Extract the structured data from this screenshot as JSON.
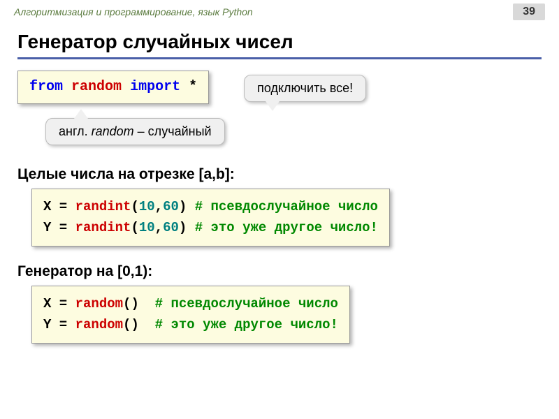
{
  "header": {
    "breadcrumb": "Алгоритмизация и программирование, язык Python",
    "page": "39"
  },
  "title": "Генератор случайных чисел",
  "import_line": {
    "kw_from": "from",
    "mod": "random",
    "kw_import": "import",
    "star": "*"
  },
  "callout_connect": "подключить все!",
  "callout_random": {
    "prefix": "англ. ",
    "word": "random",
    "suffix": " – случайный"
  },
  "section_int": "Целые числа на отрезке [a,b]:",
  "code_int": {
    "l1": {
      "var": "X",
      "eq": " = ",
      "fn": "randint",
      "open": "(",
      "a": "10",
      "comma": ",",
      "b": "60",
      "close": ") ",
      "cmt": "# псевдослучайное число"
    },
    "l2": {
      "var": "Y",
      "eq": " = ",
      "fn": "randint",
      "open": "(",
      "a": "10",
      "comma": ",",
      "b": "60",
      "close": ") ",
      "cmt": "# это уже другое число!"
    }
  },
  "section_gen": "Генератор на [0,1):",
  "code_gen": {
    "l1": {
      "var": "X",
      "eq": " = ",
      "fn": "random",
      "call": "()  ",
      "cmt": "# псевдослучайное число"
    },
    "l2": {
      "var": "Y",
      "eq": " = ",
      "fn": "random",
      "call": "()  ",
      "cmt": "# это уже другое число!"
    }
  }
}
